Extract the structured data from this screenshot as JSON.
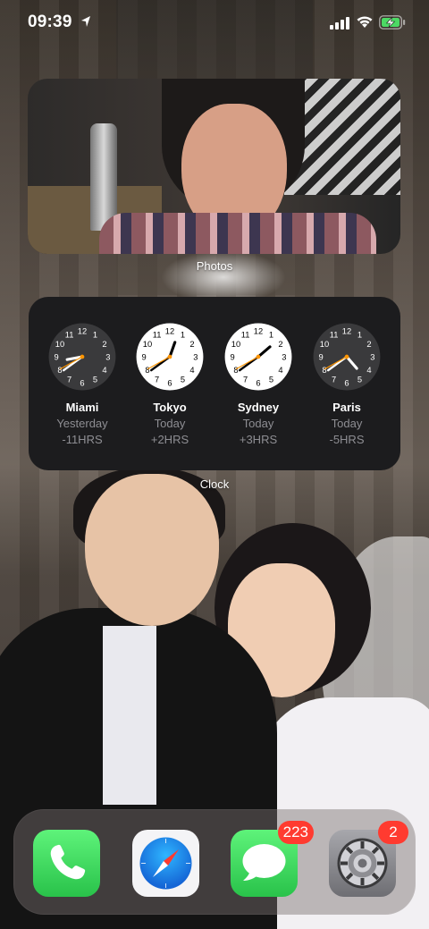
{
  "status_bar": {
    "time": "09:39",
    "location_icon": "location-arrow-icon",
    "signal_icon": "cellular-signal-icon",
    "wifi_icon": "wifi-icon",
    "battery_icon": "battery-charging-icon",
    "battery_color": "#4cd964"
  },
  "widgets": {
    "photos": {
      "label": "Photos"
    },
    "clock": {
      "label": "Clock",
      "cities": [
        {
          "city": "Miami",
          "day": "Yesterday",
          "offset": "-11HRS",
          "theme": "dark",
          "hour": 8,
          "minute": 39
        },
        {
          "city": "Tokyo",
          "day": "Today",
          "offset": "+2HRS",
          "theme": "light",
          "hour": 12,
          "minute": 39
        },
        {
          "city": "Sydney",
          "day": "Today",
          "offset": "+3HRS",
          "theme": "light",
          "hour": 1,
          "minute": 39
        },
        {
          "city": "Paris",
          "day": "Today",
          "offset": "-5HRS",
          "theme": "dark",
          "hour": 4,
          "minute": 39
        }
      ]
    }
  },
  "dock": {
    "apps": [
      {
        "name": "Phone",
        "icon": "phone-icon",
        "badge": ""
      },
      {
        "name": "Safari",
        "icon": "compass-icon",
        "badge": ""
      },
      {
        "name": "Messages",
        "icon": "message-icon",
        "badge": "223"
      },
      {
        "name": "Settings",
        "icon": "gear-icon",
        "badge": "2"
      }
    ]
  },
  "colors": {
    "clock_second_hand": "#ff9500",
    "badge": "#ff3b30",
    "phone_green": "#34c759",
    "messages_green": "#34c759",
    "safari_blue": "#1e88e5"
  }
}
